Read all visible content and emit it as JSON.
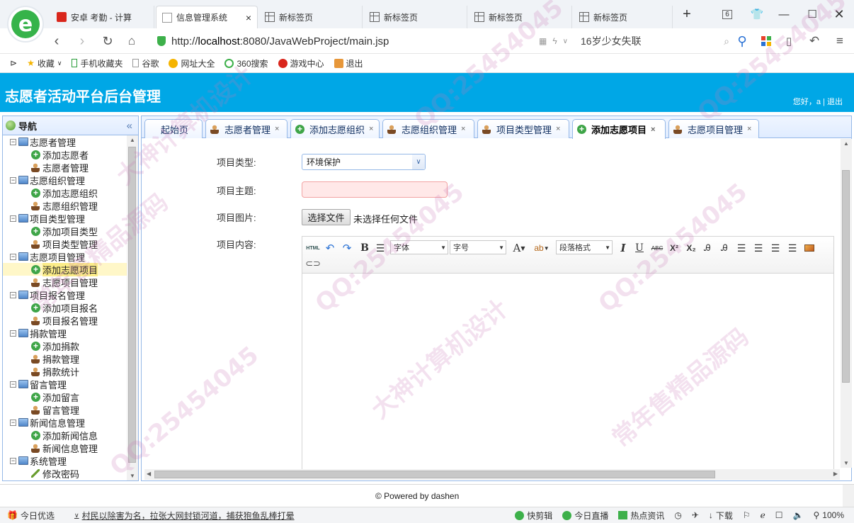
{
  "browser": {
    "logo_letter": "e",
    "tabs": [
      {
        "label": "安卓 考勤 - 计算",
        "icon": "red-app-icon"
      },
      {
        "label": "信息管理系统",
        "icon": "page-icon",
        "active": true
      },
      {
        "label": "新标签页",
        "icon": "newtab-icon"
      },
      {
        "label": "新标签页",
        "icon": "newtab-icon"
      },
      {
        "label": "新标签页",
        "icon": "newtab-icon"
      },
      {
        "label": "新标签页",
        "icon": "newtab-icon"
      }
    ],
    "new_tab": "+",
    "tab_count": "6",
    "url_prefix": "http://",
    "url_host": "localhost",
    "url_rest": ":8080/JavaWebProject/main.jsp",
    "search_text": "16岁少女失联",
    "bookmarks": [
      "收藏",
      "手机收藏夹",
      "谷歌",
      "网址大全",
      "360搜索",
      "游戏中心",
      "退出"
    ]
  },
  "app": {
    "title": "志愿者活动平台后台管理",
    "greeting": "您好，a",
    "separator": "|",
    "logout": "退出"
  },
  "nav": {
    "title": "导航",
    "collapse": "«",
    "groups": [
      {
        "label": "志愿者管理",
        "items": [
          "添加志愿者",
          "志愿者管理"
        ]
      },
      {
        "label": "志愿组织管理",
        "items": [
          "添加志愿组织",
          "志愿组织管理"
        ]
      },
      {
        "label": "项目类型管理",
        "items": [
          "添加项目类型",
          "项目类型管理"
        ]
      },
      {
        "label": "志愿项目管理",
        "items": [
          "添加志愿项目",
          "志愿项目管理"
        ]
      },
      {
        "label": "项目报名管理",
        "items": [
          "添加项目报名",
          "项目报名管理"
        ]
      },
      {
        "label": "捐款管理",
        "items": [
          "添加捐款",
          "捐款管理",
          "捐款统计"
        ]
      },
      {
        "label": "留言管理",
        "items": [
          "添加留言",
          "留言管理"
        ]
      },
      {
        "label": "新闻信息管理",
        "items": [
          "添加新闻信息",
          "新闻信息管理"
        ]
      },
      {
        "label": "系统管理",
        "items": [
          "修改密码"
        ]
      }
    ],
    "selected": "添加志愿项目"
  },
  "tabs": [
    {
      "label": "起始页",
      "closable": false
    },
    {
      "label": "志愿者管理",
      "closable": true
    },
    {
      "label": "添加志愿组织",
      "closable": true
    },
    {
      "label": "志愿组织管理",
      "closable": true
    },
    {
      "label": "项目类型管理",
      "closable": true
    },
    {
      "label": "添加志愿项目",
      "closable": true,
      "active": true
    },
    {
      "label": "志愿项目管理",
      "closable": true
    }
  ],
  "form": {
    "type_label": "项目类型:",
    "type_value": "环境保护",
    "subject_label": "项目主题:",
    "subject_value": "",
    "image_label": "项目图片:",
    "file_button": "选择文件",
    "file_status": "未选择任何文件",
    "content_label": "项目内容:"
  },
  "editor": {
    "html_btn": "HTML",
    "bold": "B",
    "font_family": "字体",
    "font_size": "字号",
    "font_color": "A",
    "paragraph": "段落格式",
    "italic": "I",
    "underline": "U",
    "strike": "ABC",
    "sup": "X²",
    "sub": "X₂"
  },
  "footer": "© Powered by dashen",
  "statusbar": {
    "left1": "今日优选",
    "news": "村民以除害为名，拉张大网封锁河道，捕获狍鱼乱棒打晕",
    "items": [
      "快剪辑",
      "今日直播",
      "热点资讯"
    ],
    "download": "下载",
    "zoom": "100%"
  },
  "watermark": [
    "QQ:25454045",
    "大神计算机设计",
    "常年售精品源码"
  ],
  "colors": {
    "header": "#00a7e6",
    "panel_border": "#95b8e7",
    "selected": "#fbec88"
  }
}
